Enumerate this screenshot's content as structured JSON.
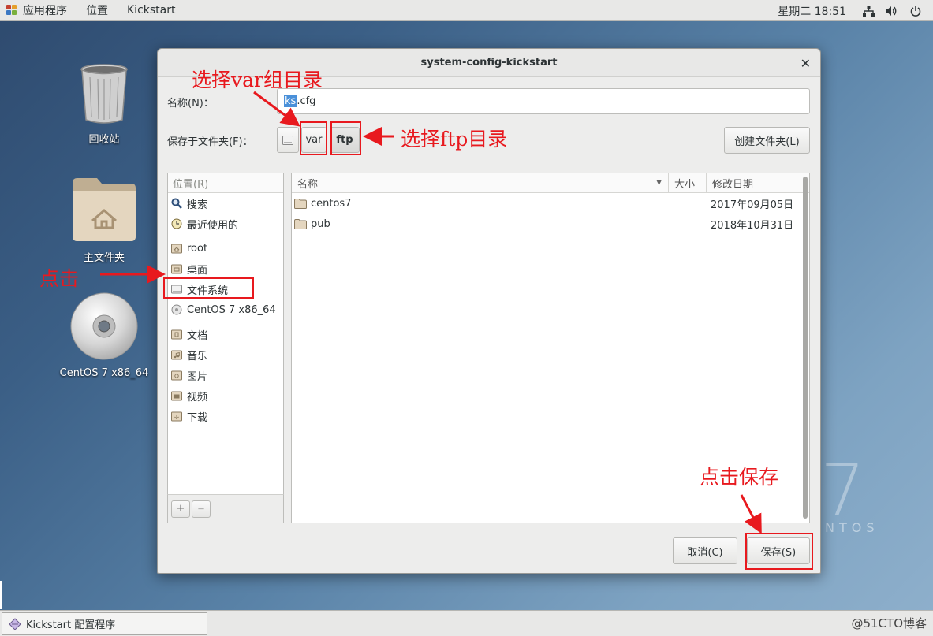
{
  "topbar": {
    "applications": "应用程序",
    "places": "位置",
    "app_name": "Kickstart",
    "clock": "星期二 18:51"
  },
  "desktop": {
    "trash_label": "回收站",
    "home_label": "主文件夹",
    "disc_label": "CentOS 7 x86_64",
    "watermark_num": "7",
    "watermark_text": "NTOS"
  },
  "dialog": {
    "title": "system-config-kickstart",
    "name_label": "名称(N)：",
    "name_value_selected": "ks",
    "name_value_rest": ".cfg",
    "folder_label": "保存于文件夹(F)：",
    "path_buttons": [
      "var",
      "ftp"
    ],
    "create_folder": "创建文件夹(L)",
    "places_header": "位置(R)",
    "places": [
      "搜索",
      "最近使用的",
      "root",
      "桌面",
      "文件系统",
      "CentOS 7 x86_64",
      "文档",
      "音乐",
      "图片",
      "视频",
      "下载"
    ],
    "columns": {
      "name": "名称",
      "size": "大小",
      "modified": "修改日期"
    },
    "files": [
      {
        "name": "centos7",
        "size": "",
        "modified": "2017年09月05日"
      },
      {
        "name": "pub",
        "size": "",
        "modified": "2018年10月31日"
      }
    ],
    "cancel": "取消(C)",
    "save": "保存(S)",
    "add": "+",
    "remove": "—"
  },
  "taskbar": {
    "item": "Kickstart 配置程序",
    "watermark": "@51CTO博客"
  },
  "annotations": {
    "select_var": "选择var组目录",
    "select_ftp": "选择ftp目录",
    "click": "点击",
    "click_save": "点击保存"
  },
  "colors": {
    "annotation": "#e8191e",
    "selection": "#4a90d9"
  }
}
